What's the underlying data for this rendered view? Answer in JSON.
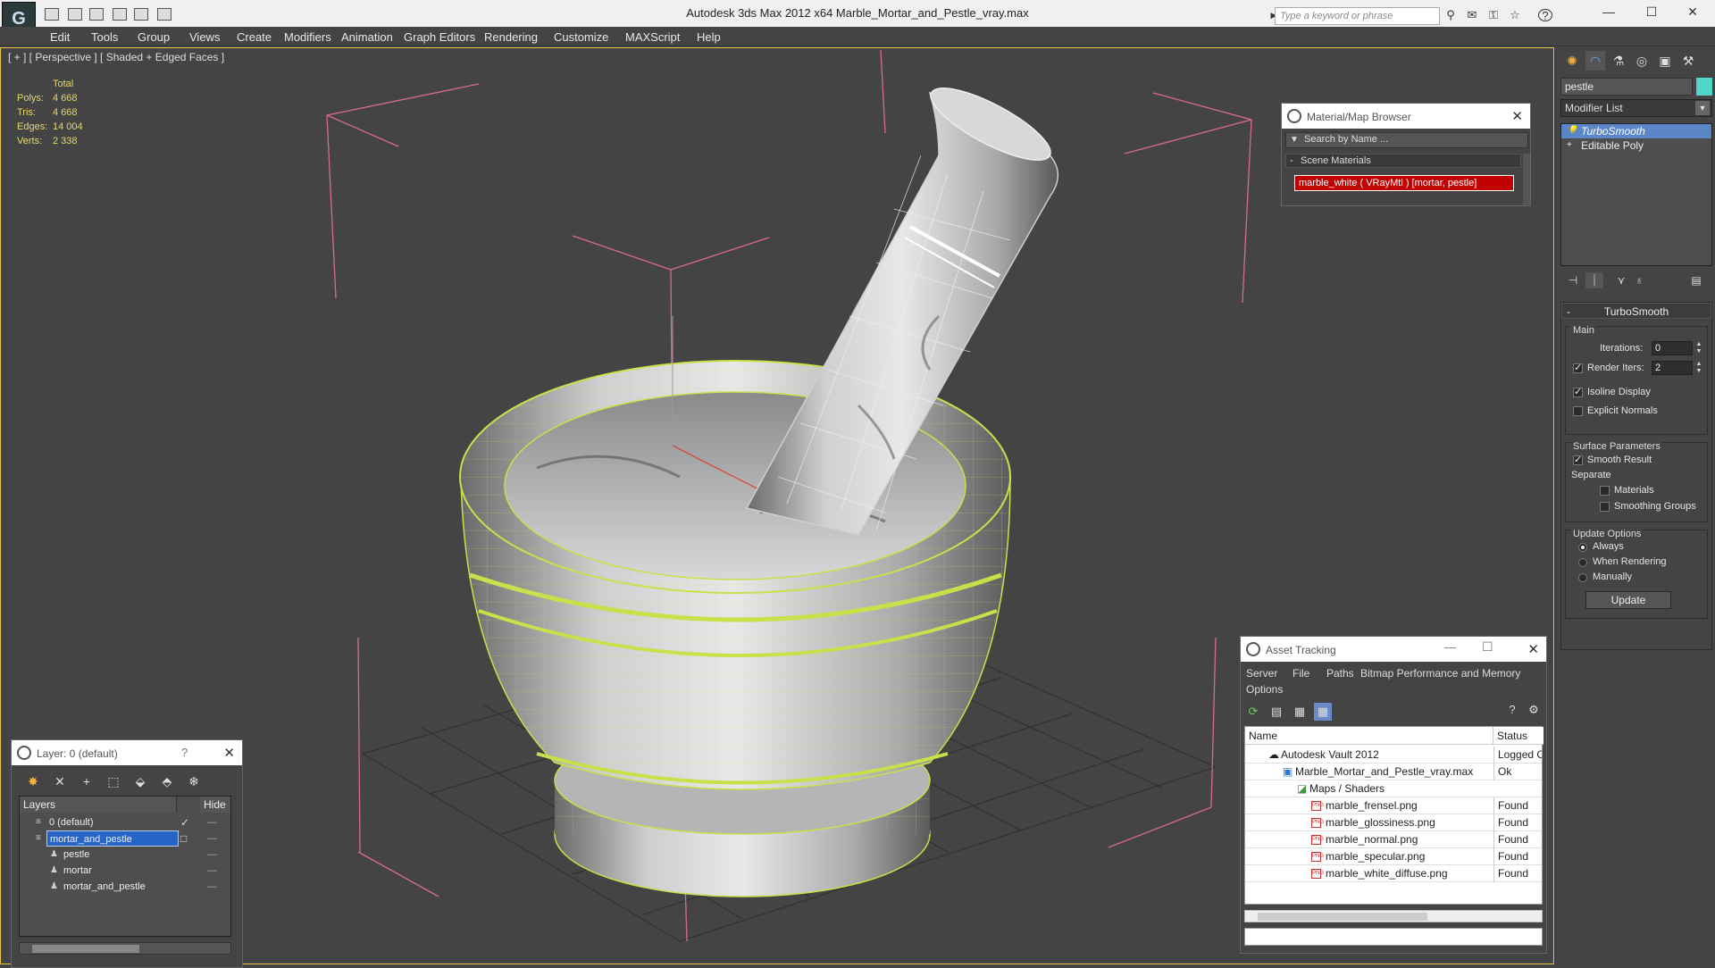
{
  "window": {
    "title": "Autodesk 3ds Max  2012 x64      Marble_Mortar_and_Pestle_vray.max",
    "search_placeholder": "Type a keyword or phrase"
  },
  "menu": [
    "Edit",
    "Tools",
    "Group",
    "Views",
    "Create",
    "Modifiers",
    "Animation",
    "Graph Editors",
    "Rendering",
    "Customize",
    "MAXScript",
    "Help"
  ],
  "viewport": {
    "label": "[ + ] [ Perspective ] [ Shaded + Edged Faces ]",
    "stats": {
      "header": "Total",
      "rows": [
        {
          "label": "Polys:",
          "value": "4 668"
        },
        {
          "label": "Tris:",
          "value": "4 668"
        },
        {
          "label": "Edges:",
          "value": "14 004"
        },
        {
          "label": "Verts:",
          "value": "2 338"
        }
      ]
    },
    "colors": {
      "bbox": "#d86a8a",
      "wire": "#c8e04a",
      "grid": "#555555"
    }
  },
  "command_panel": {
    "object_name": "pestle",
    "object_color": "#4fd6c9",
    "modifier_list_label": "Modifier List",
    "stack": [
      {
        "label": "TurboSmooth",
        "selected": true
      },
      {
        "label": "Editable Poly",
        "selected": false
      }
    ],
    "turbosmooth": {
      "title": "TurboSmooth",
      "main_label": "Main",
      "iterations_label": "Iterations:",
      "iterations_value": "0",
      "render_iters_label": "Render Iters:",
      "render_iters_value": "2",
      "isoline_display": "Isoline Display",
      "explicit_normals": "Explicit Normals",
      "surface_parameters": "Surface Parameters",
      "smooth_result": "Smooth Result",
      "separate": "Separate",
      "materials": "Materials",
      "smoothing_groups": "Smoothing Groups",
      "update_options": "Update Options",
      "always": "Always",
      "when_rendering": "When Rendering",
      "manually": "Manually",
      "update_button": "Update"
    }
  },
  "material_browser": {
    "title": "Material/Map Browser",
    "search_placeholder": "Search by Name ...",
    "section": "Scene Materials",
    "material": "marble_white  ( VRayMtl )  [mortar, pestle]"
  },
  "layer_manager": {
    "title": "Layer: 0 (default)",
    "help": "?",
    "col_layers": "Layers",
    "col_hide": "Hide",
    "rows": [
      {
        "name": "0 (default)",
        "indent": 1,
        "check": "✓",
        "selected": false
      },
      {
        "name": "mortar_and_pestle",
        "indent": 1,
        "check": "□",
        "selected": true
      },
      {
        "name": "pestle",
        "indent": 2,
        "check": "",
        "selected": false
      },
      {
        "name": "mortar",
        "indent": 2,
        "check": "",
        "selected": false
      },
      {
        "name": "mortar_and_pestle",
        "indent": 2,
        "check": "",
        "selected": false
      }
    ]
  },
  "asset_tracking": {
    "title": "Asset Tracking",
    "menu": [
      "Server",
      "File",
      "Paths",
      "Bitmap Performance and Memory",
      "Options"
    ],
    "col_name": "Name",
    "col_status": "Status",
    "rows": [
      {
        "name": "Autodesk Vault 2012",
        "status": "Logged Out",
        "indent": 1
      },
      {
        "name": "Marble_Mortar_and_Pestle_vray.max",
        "status": "Ok",
        "indent": 2
      },
      {
        "name": "Maps / Shaders",
        "status": "",
        "indent": 3
      },
      {
        "name": "marble_frensel.png",
        "status": "Found",
        "indent": 4
      },
      {
        "name": "marble_glossiness.png",
        "status": "Found",
        "indent": 4
      },
      {
        "name": "marble_normal.png",
        "status": "Found",
        "indent": 4
      },
      {
        "name": "marble_specular.png",
        "status": "Found",
        "indent": 4
      },
      {
        "name": "marble_white_diffuse.png",
        "status": "Found",
        "indent": 4
      }
    ]
  }
}
